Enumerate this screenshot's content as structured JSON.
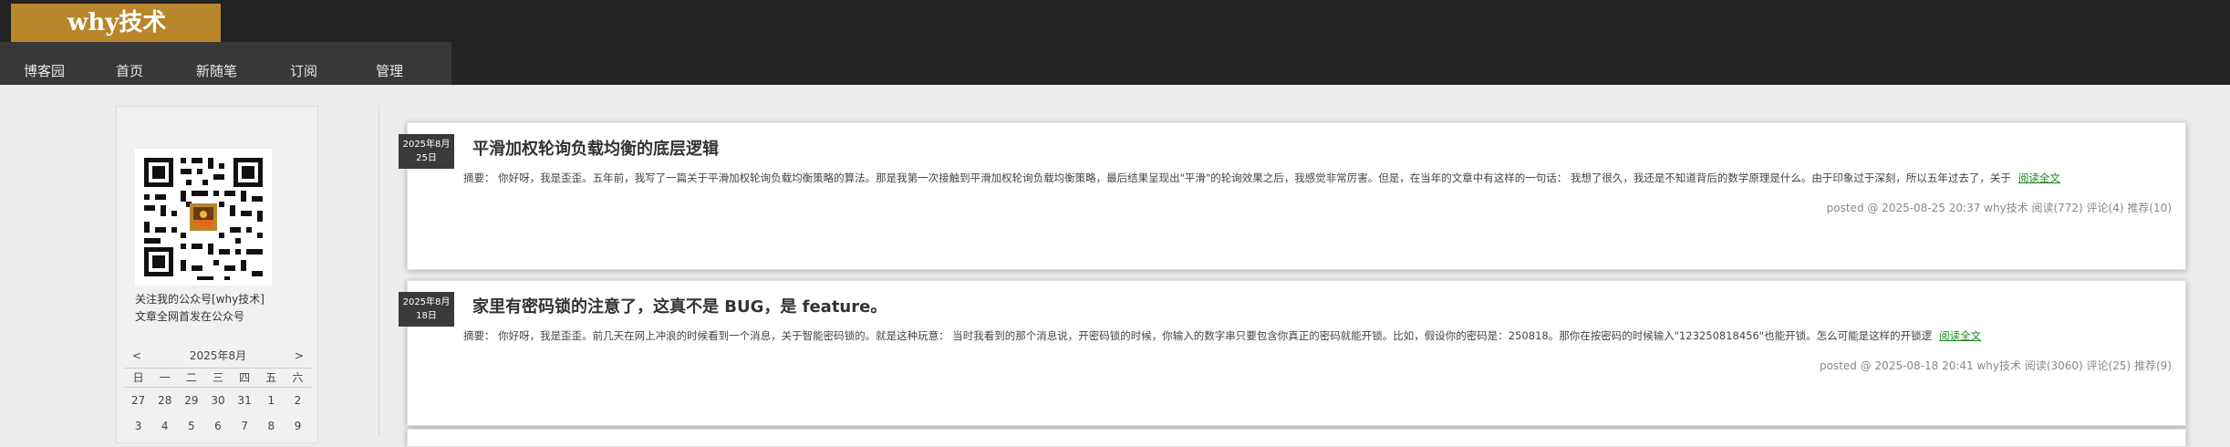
{
  "header": {
    "logo": "why技术",
    "nav": [
      "博客园",
      "首页",
      "新随笔",
      "订阅",
      "管理"
    ]
  },
  "sidebar": {
    "follow_line1": "关注我的公众号[why技术]",
    "follow_line2": "文章全网首发在公众号",
    "calendar": {
      "prev": "<",
      "title": "2025年8月",
      "next": ">",
      "weekdays": [
        "日",
        "一",
        "二",
        "三",
        "四",
        "五",
        "六"
      ],
      "rows": [
        [
          "27",
          "28",
          "29",
          "30",
          "31",
          "1",
          "2"
        ],
        [
          "3",
          "4",
          "5",
          "6",
          "7",
          "8",
          "9"
        ]
      ]
    }
  },
  "posts": [
    {
      "date_line1": "2025年8月",
      "date_line2": "25日",
      "title": "平滑加权轮询负载均衡的底层逻辑",
      "summary": "摘要： 你好呀，我是歪歪。五年前，我写了一篇关于平滑加权轮询负载均衡策略的算法。那是我第一次接触到平滑加权轮询负载均衡策略，最后结果呈现出\"平滑\"的轮询效果之后，我感觉非常厉害。但是，在当年的文章中有这样的一句话： 我想了很久，我还是不知道背后的数学原理是什么。由于印象过于深刻，所以五年过去了，关于",
      "read_more": "阅读全文",
      "meta": "posted @ 2025-08-25 20:37 why技术 阅读(772) 评论(4) 推荐(10)"
    },
    {
      "date_line1": "2025年8月",
      "date_line2": "18日",
      "title": "家里有密码锁的注意了，这真不是 BUG，是 feature。",
      "summary": "摘要： 你好呀，我是歪歪。前几天在网上冲浪的时候看到一个消息，关于智能密码锁的。就是这种玩意： 当时我看到的那个消息说，开密码锁的时候，你输入的数字串只要包含你真正的密码就能开锁。比如，假设你的密码是：250818。那你在按密码的时候输入\"123250818456\"也能开锁。怎么可能是这样的开锁逻",
      "read_more": "阅读全文",
      "meta": "posted @ 2025-08-18 20:41 why技术 阅读(3060) 评论(25) 推荐(9)"
    }
  ]
}
